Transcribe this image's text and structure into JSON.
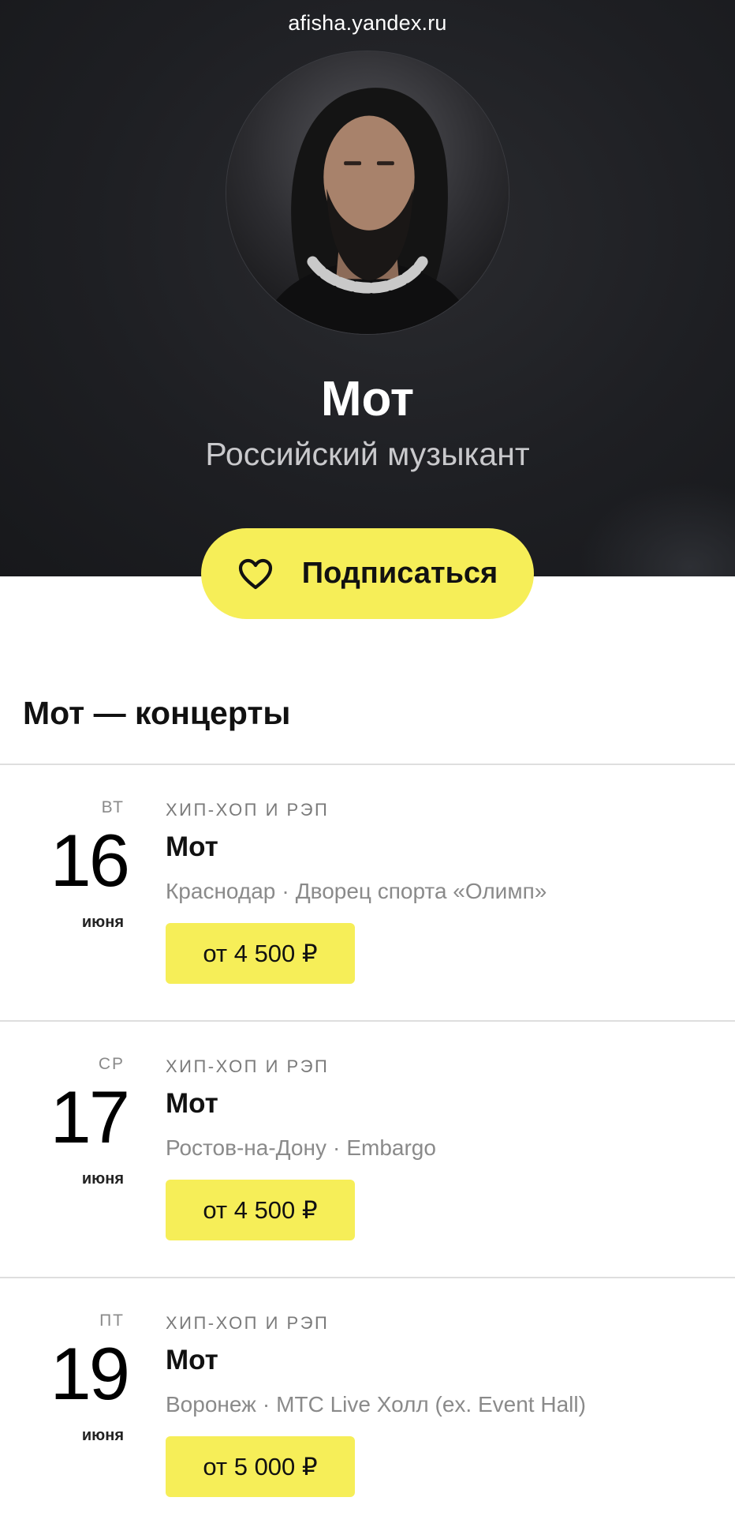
{
  "browser": {
    "url": "afisha.yandex.ru"
  },
  "artist": {
    "name": "Мот",
    "subtitle": "Российский музыкант",
    "subscribe_label": "Подписаться"
  },
  "concerts": {
    "title": "Мот — концерты",
    "events": [
      {
        "weekday": "ВТ",
        "day": "16",
        "month": "июня",
        "genre": "ХИП-ХОП И РЭП",
        "title": "Мот",
        "city": "Краснодар",
        "venue": "Дворец спорта «Олимп»",
        "price": "от 4 500 ₽"
      },
      {
        "weekday": "СР",
        "day": "17",
        "month": "июня",
        "genre": "ХИП-ХОП И РЭП",
        "title": "Мот",
        "city": "Ростов-на-Дону",
        "venue": "Embargo",
        "price": "от 4 500 ₽"
      },
      {
        "weekday": "ПТ",
        "day": "19",
        "month": "июня",
        "genre": "ХИП-ХОП И РЭП",
        "title": "Мот",
        "city": "Воронеж",
        "venue": "МТС Live Холл (ex. Event Hall)",
        "price": "от 5 000 ₽"
      }
    ]
  },
  "colors": {
    "hero_background": "#1e1f23",
    "accent_yellow": "#f6ee58",
    "muted_text": "#8a8a8a"
  },
  "icons": {
    "subscribe": "heart-outline-icon",
    "separator": "middle-dot"
  }
}
